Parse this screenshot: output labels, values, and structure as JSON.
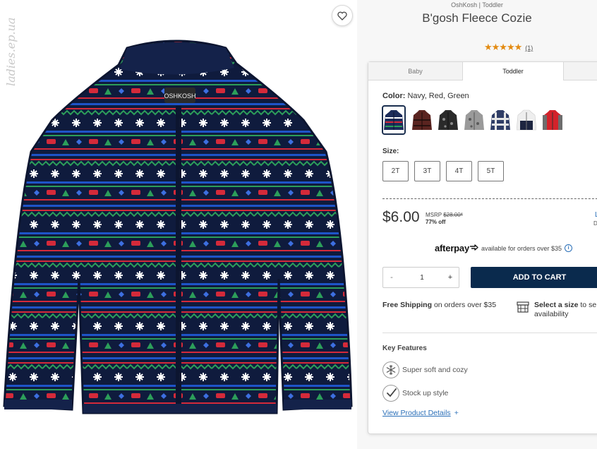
{
  "watermark": "ladies.ep.ua",
  "product": {
    "brand_line": "OshKosh | Toddler",
    "title": "B'gosh Fleece Cozie",
    "stars": "★★★★★",
    "review_count": "(1)",
    "jacket_label": "OSHKOSH"
  },
  "tabs": [
    {
      "label": "Baby"
    },
    {
      "label": "Toddler"
    }
  ],
  "color": {
    "label": "Color:",
    "selected": "Navy, Red, Green",
    "swatches": [
      {
        "name": "navy fair isle",
        "color": "#1c2c5a",
        "selected": true
      },
      {
        "name": "burgundy plaid",
        "color": "#5a2420"
      },
      {
        "name": "black print",
        "color": "#2a2a2a"
      },
      {
        "name": "grey print",
        "color": "#8a8a8a"
      },
      {
        "name": "navy white plaid",
        "color": "#2f3d66"
      },
      {
        "name": "navy white colorblock",
        "color": "#1d2540"
      },
      {
        "name": "red grey colorblock",
        "color": "#d3222a"
      }
    ]
  },
  "size": {
    "label": "Size:",
    "options": [
      "2T",
      "3T",
      "4T",
      "5T"
    ]
  },
  "price": {
    "current": "$6.00",
    "msrp_label": "MSRP",
    "msrp": "$28.00*",
    "discount": "77% off",
    "edge_link": "L",
    "edge_text": "D"
  },
  "afterpay": {
    "logo": "afterpay",
    "text": "available for orders over $35",
    "info": "i"
  },
  "cart": {
    "minus": "-",
    "quantity": "1",
    "plus": "+",
    "add_label": "ADD TO CART"
  },
  "shipping": {
    "bold": "Free Shipping",
    "rest": "on orders over $35"
  },
  "store": {
    "bold": "Select a size",
    "rest": "to se",
    "line2": "availability"
  },
  "features": {
    "heading": "Key Features",
    "items": [
      {
        "text": "Super soft and cozy",
        "icon": "snowflake-icon"
      },
      {
        "text": "Stock up style",
        "icon": "checkmark-icon"
      }
    ],
    "details_link": "View Product Details",
    "details_plus": "+"
  },
  "colors": {
    "navy": "#0a2a4d",
    "star": "#e38b12",
    "link": "#2a6fb8"
  }
}
